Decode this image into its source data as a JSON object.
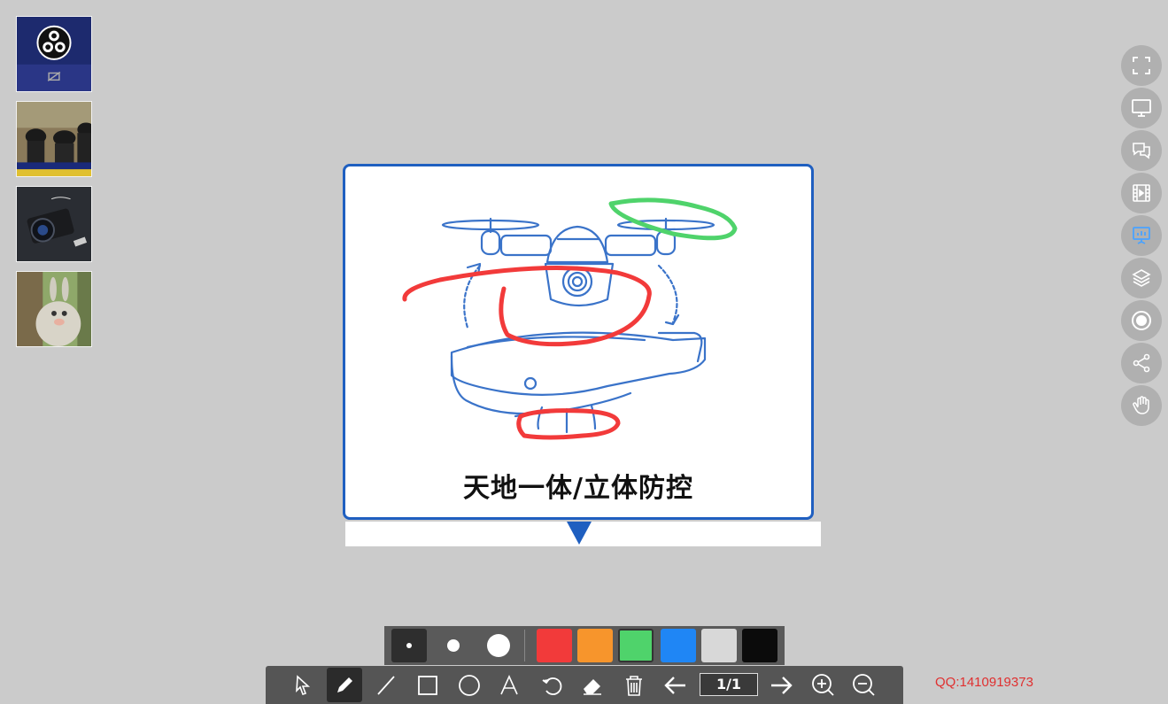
{
  "thumbnails": [
    {
      "label": "obs-preview",
      "icon": "obs-logo-icon"
    },
    {
      "label": "thumbnail-2",
      "icon": "photo-icon"
    },
    {
      "label": "thumbnail-3",
      "icon": "photo-icon"
    },
    {
      "label": "thumbnail-4",
      "icon": "photo-icon"
    }
  ],
  "slide": {
    "title": "天地一体/立体防控"
  },
  "right_toolbar": [
    {
      "name": "fullscreen",
      "icon": "fullscreen-icon"
    },
    {
      "name": "screen-share",
      "icon": "monitor-icon"
    },
    {
      "name": "chat",
      "icon": "chat-icon"
    },
    {
      "name": "video",
      "icon": "film-icon"
    },
    {
      "name": "whiteboard",
      "icon": "presentation-icon"
    },
    {
      "name": "layers",
      "icon": "layers-icon"
    },
    {
      "name": "record",
      "icon": "record-icon"
    },
    {
      "name": "share",
      "icon": "share-icon"
    },
    {
      "name": "hand",
      "icon": "hand-icon"
    }
  ],
  "pen_sizes": [
    "small",
    "medium",
    "large"
  ],
  "pen_colors": [
    "#f23a3a",
    "#f7952c",
    "#4fd36b",
    "#1f86f5",
    "#d8d8d8",
    "#0b0b0b"
  ],
  "active_color": "#4fd36b",
  "bottom_toolbar": {
    "tools": [
      "select-icon",
      "pen-icon",
      "line-icon",
      "rectangle-icon",
      "circle-icon",
      "text-icon",
      "undo-icon",
      "eraser-icon",
      "trash-icon",
      "arrow-left-icon",
      "arrow-right-icon",
      "zoom-in-icon",
      "zoom-out-icon"
    ],
    "page_indicator": "1/1"
  },
  "footer": {
    "qq": "QQ:1410919373"
  },
  "colors": {
    "background": "#cbcbcb",
    "slide_border": "#1f5fc0",
    "drone_line": "#3a73c9",
    "annotation_red": "#f23a3a",
    "annotation_green": "#4fd36b"
  }
}
